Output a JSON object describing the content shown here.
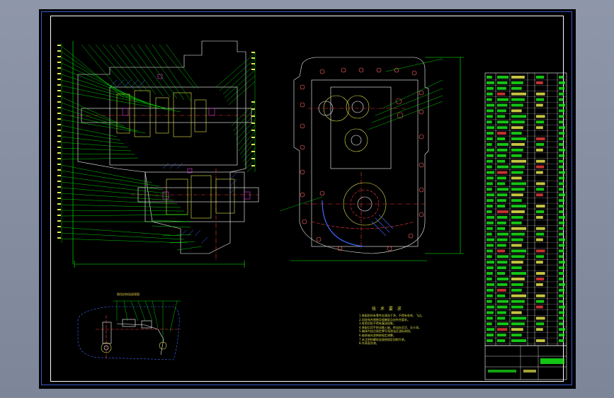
{
  "drawing": {
    "technical_requirements": {
      "title": "技 术 要 求",
      "notes": [
        "1.装配前所有零件应清洗干净，不得有毛刺、飞边。",
        "2.齿轮啮合侧隙及接触斑点应符合要求。",
        "3.各密封处不得有漏油现象。",
        "4.装配后用手转动输入轴，转动应灵活、无卡滞。",
        "5.箱体内加注规定牌号润滑油至油标刻线。",
        "6.轴承轴向游隙按规定调整。",
        "7.未注明的螺纹连接按规定扭矩拧紧。",
        "8.外表面涂漆。"
      ]
    },
    "partial_view_label": "换挡机构局部视图"
  },
  "colors": {
    "sheet": "#000000",
    "frame_outer": "#3a5bd0",
    "outline": "#ffffff",
    "leader": "#00ff00",
    "hatch": "#3d6bff",
    "center_line": "#ff3b3b",
    "table_green": "#19e619",
    "table_yellow": "#e6e64d",
    "table_red": "#e63b3b"
  },
  "icons": [
    "gearbox-section-icon",
    "housing-end-view-icon",
    "shift-mechanism-icon"
  ]
}
